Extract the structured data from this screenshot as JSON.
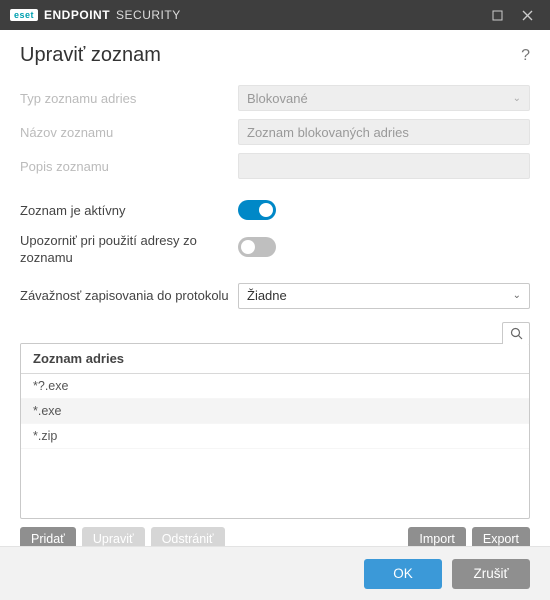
{
  "titlebar": {
    "logo_text": "eset",
    "product_strong": "ENDPOINT",
    "product_light": "SECURITY"
  },
  "header": {
    "title": "Upraviť zoznam",
    "help_icon": "?"
  },
  "form": {
    "list_type_label": "Typ zoznamu adries",
    "list_type_value": "Blokované",
    "list_name_label": "Názov zoznamu",
    "list_name_value": "Zoznam blokovaných adries",
    "list_desc_label": "Popis zoznamu",
    "list_desc_value": "",
    "active_label": "Zoznam je aktívny",
    "active_on": true,
    "notify_label": "Upozorniť pri použití adresy zo zoznamu",
    "notify_on": false,
    "severity_label": "Závažnosť zapisovania do protokolu",
    "severity_value": "Žiadne"
  },
  "table": {
    "header": "Zoznam adries",
    "rows": [
      "*?.exe",
      "*.exe",
      "*.zip"
    ]
  },
  "buttons": {
    "add": "Pridať",
    "edit": "Upraviť",
    "delete": "Odstrániť",
    "import": "Import",
    "export": "Export",
    "ok": "OK",
    "cancel": "Zrušiť"
  }
}
